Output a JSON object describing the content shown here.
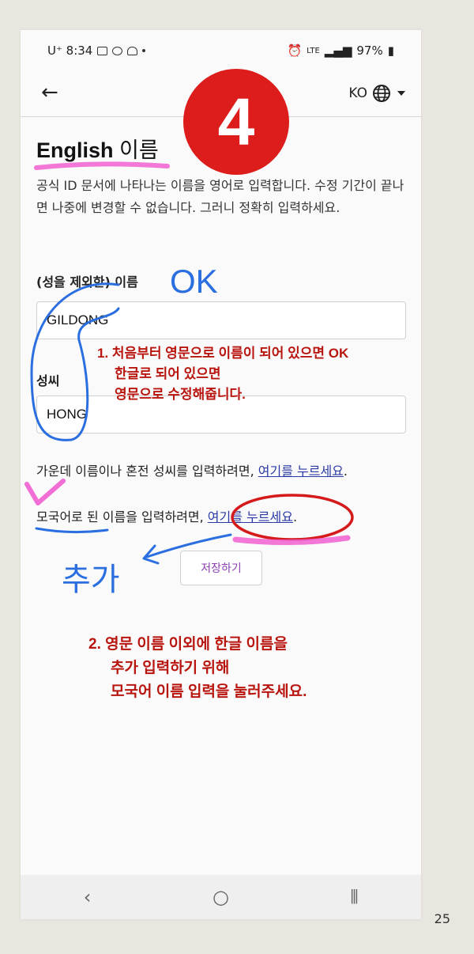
{
  "status_bar": {
    "carrier": "U⁺ 8:34",
    "network": "LTE",
    "battery": "97%"
  },
  "app_bar": {
    "lang": "KO"
  },
  "step_badge": "4",
  "section": {
    "title_en": "English",
    "title_kr": "이름",
    "description": "공식 ID 문서에 나타나는 이름을 영어로 입력합니다. 수정 기간이 끝나면 나중에 변경할 수 없습니다. 그러니 정확히 입력하세요."
  },
  "fields": {
    "given_label": "(성을 제외한) 이름",
    "given_value": "GILDONG",
    "family_label": "성씨",
    "family_value": "HONG"
  },
  "helpers": {
    "middle_prefix": "가운데 이름이나 혼전 성씨를 입력하려면, ",
    "middle_link": "여기를 누르세요",
    "middle_suffix": ".",
    "native_prefix": "모국어로 된 이름을 입력하려면, ",
    "native_link": "여기를 누르세요",
    "native_suffix": "."
  },
  "save_button": "저장하기",
  "annotations": {
    "ok": "OK",
    "add": "추가",
    "note1_line1": "1. 처음부터 영문으로 이름이 되어 있으면 OK",
    "note1_line2": "한글로 되어 있으면",
    "note1_line3": "영문으로 수정해줍니다.",
    "note2_line1": "2. 영문 이름 이외에 한글 이름을",
    "note2_line2": "추가 입력하기 위해",
    "note2_line3": "모국어 이름 입력을 눌러주세요."
  },
  "page_number": "25",
  "colors": {
    "annotation_red": "#b8150f",
    "badge_red": "#dd1c1c",
    "pen_blue": "#2a6ee0",
    "highlighter_pink": "#f05fd0",
    "link_blue": "#2b3aa6",
    "button_purple": "#8c3fb0"
  }
}
